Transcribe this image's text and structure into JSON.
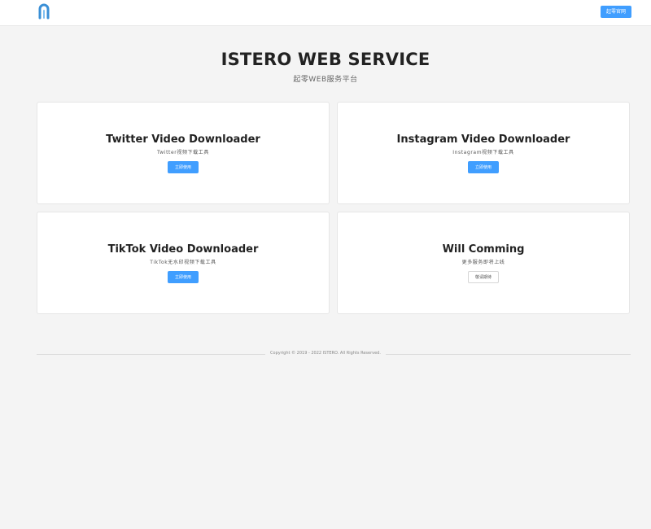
{
  "header": {
    "logo_icon": "istero-logo-icon",
    "official_site_label": "起零官网",
    "accent_color": "#409eff"
  },
  "hero": {
    "title": "ISTERO WEB SERVICE",
    "subtitle": "起零WEB服务平台"
  },
  "cards": [
    {
      "title": "Twitter Video Downloader",
      "description": "Twitter视频下载工具",
      "button_label": "立即使用",
      "button_style": "primary"
    },
    {
      "title": "Instagram Video Downloader",
      "description": "Instagram视频下载工具",
      "button_label": "立即使用",
      "button_style": "primary"
    },
    {
      "title": "TikTok Video Downloader",
      "description": "TikTok无水印视频下载工具",
      "button_label": "立即使用",
      "button_style": "primary"
    },
    {
      "title": "Will Comming",
      "description": "更多服务即将上线",
      "button_label": "敬请期待",
      "button_style": "default"
    }
  ],
  "footer": {
    "copyright": "Copyright © 2019 - 2022 ISTERO. All Rights Reserved."
  }
}
